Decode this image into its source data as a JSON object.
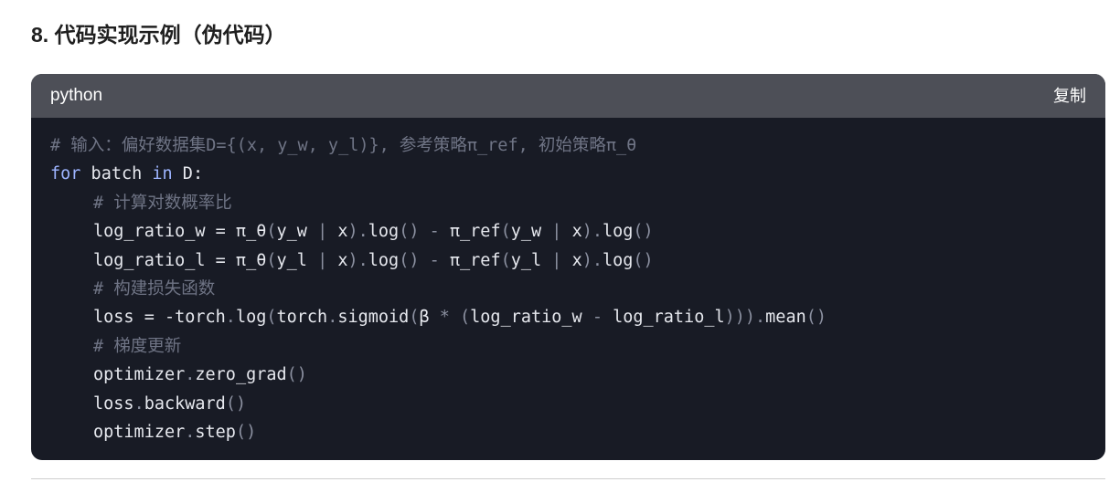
{
  "section": {
    "heading": "8. 代码实现示例（伪代码）"
  },
  "code_block": {
    "language": "python",
    "copy_label": "复制",
    "lines": {
      "l1": {
        "comment": "# 输入：偏好数据集D={(x, y_w, y_l)}, 参考策略π_ref, 初始策略π_θ"
      },
      "l2": {
        "kw_for": "for",
        "batch": " batch ",
        "kw_in": "in",
        "rest": " D:"
      },
      "l3": {
        "comment": "# 计算对数概率比"
      },
      "l4": {
        "a": "log_ratio_w = π_θ",
        "p1": "(",
        "b": "y_w ",
        "bar1": "|",
        "c": " x",
        "p2": ").",
        "d": "log",
        "p3": "()",
        "minus": " - ",
        "e": "π_ref",
        "p4": "(",
        "f": "y_w ",
        "bar2": "|",
        "g": " x",
        "p5": ").",
        "h": "log",
        "p6": "()"
      },
      "l5": {
        "a": "log_ratio_l = π_θ",
        "p1": "(",
        "b": "y_l ",
        "bar1": "|",
        "c": " x",
        "p2": ").",
        "d": "log",
        "p3": "()",
        "minus": " - ",
        "e": "π_ref",
        "p4": "(",
        "f": "y_l ",
        "bar2": "|",
        "g": " x",
        "p5": ").",
        "h": "log",
        "p6": "()"
      },
      "l6": {
        "comment": "# 构建损失函数"
      },
      "l7": {
        "a": "loss = -torch",
        "d1": ".",
        "b": "log",
        "p1": "(",
        "c": "torch",
        "d2": ".",
        "d": "sigmoid",
        "p2": "(",
        "e": "β ",
        "star": "*",
        "sp": " ",
        "p3": "(",
        "f": "log_ratio_w ",
        "minus": "-",
        "g": " log_ratio_l",
        "p4": "))).",
        "h": "mean",
        "p5": "()"
      },
      "l8": {
        "comment": "# 梯度更新"
      },
      "l9": {
        "a": "optimizer",
        "d": ".",
        "b": "zero_grad",
        "p": "()"
      },
      "l10": {
        "a": "loss",
        "d": ".",
        "b": "backward",
        "p": "()"
      },
      "l11": {
        "a": "optimizer",
        "d": ".",
        "b": "step",
        "p": "()"
      }
    }
  },
  "colors": {
    "code_background": "#181b25",
    "header_background": "#4d4f57",
    "code_text": "#e6e8ee",
    "comment": "#6f7485",
    "keyword": "#9db4ff",
    "punctuation": "#8b90a0"
  }
}
